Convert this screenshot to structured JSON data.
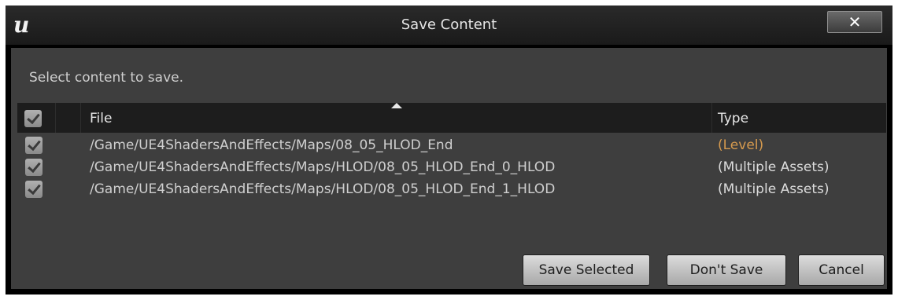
{
  "window": {
    "title": "Save Content",
    "close_label": "✕",
    "logo_glyph": "u"
  },
  "prompt": "Select content to save.",
  "table": {
    "columns": [
      "File",
      "Type"
    ],
    "rows": [
      {
        "checked": true,
        "file": "/Game/UE4ShadersAndEffects/Maps/08_05_HLOD_End",
        "type": "(Level)",
        "type_color": "#d69a4e"
      },
      {
        "checked": true,
        "file": "/Game/UE4ShadersAndEffects/Maps/HLOD/08_05_HLOD_End_0_HLOD",
        "type": "(Multiple Assets)",
        "type_color": "#dcdcdc"
      },
      {
        "checked": true,
        "file": "/Game/UE4ShadersAndEffects/Maps/HLOD/08_05_HLOD_End_1_HLOD",
        "type": "(Multiple Assets)",
        "type_color": "#dcdcdc"
      }
    ]
  },
  "buttons": {
    "save_selected": "Save Selected",
    "dont_save": "Don't Save",
    "cancel": "Cancel"
  }
}
